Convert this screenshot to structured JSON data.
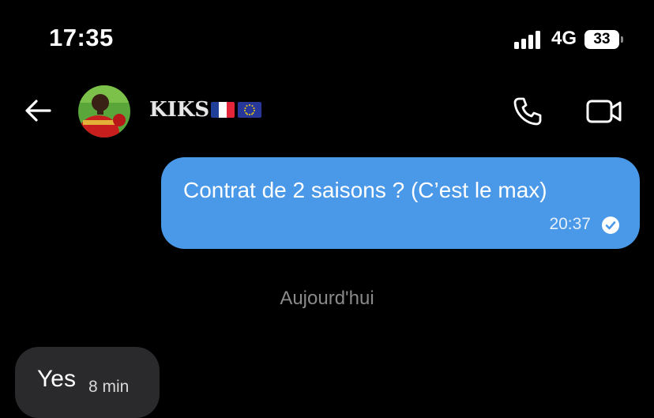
{
  "status_bar": {
    "time": "17:35",
    "network": "4G",
    "battery": "33",
    "signal_bars": 4
  },
  "header": {
    "contact_name": "KIKS",
    "back_icon": "arrow-left-icon",
    "call_icon": "phone-icon",
    "video_icon": "video-camera-icon",
    "flags": [
      "flag-france",
      "flag-european-union"
    ]
  },
  "messages": {
    "outgoing": {
      "text": "Contrat de 2 saisons ? (C’est le max)",
      "time": "20:37",
      "status_icon": "read-check-icon"
    },
    "date_separator": "Aujourd'hui",
    "incoming": {
      "text": "Yes",
      "time": "8 min"
    }
  },
  "colors": {
    "background": "#000000",
    "outgoing_bubble": "#4a98e8",
    "incoming_bubble": "#2a2a2c",
    "separator_text": "#8a8a8a"
  }
}
